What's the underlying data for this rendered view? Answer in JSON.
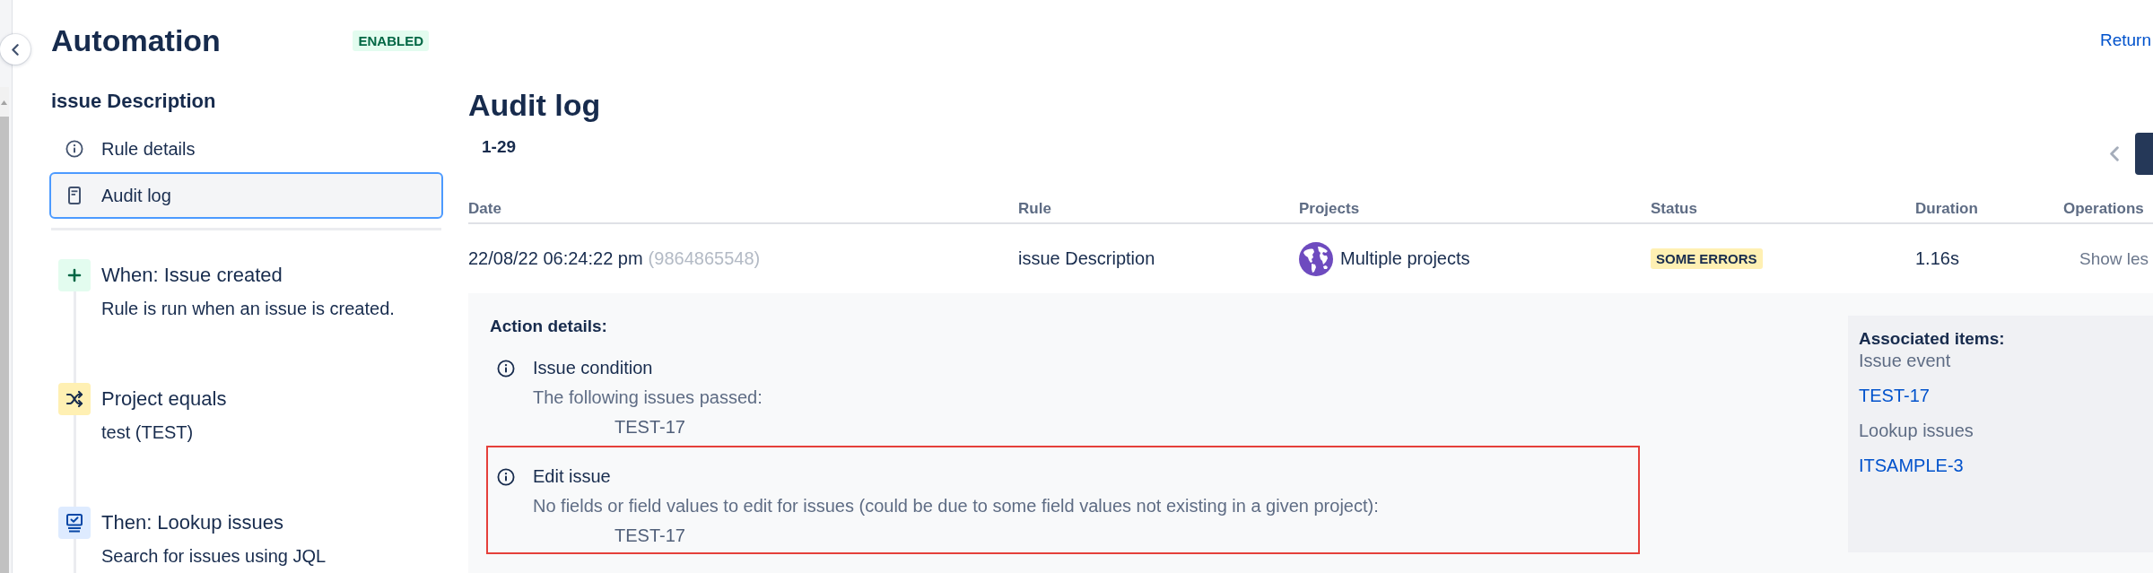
{
  "sidebar": {
    "title": "Automation",
    "status": "ENABLED",
    "rule_name": "issue Description",
    "nav": [
      {
        "label": "Rule details",
        "selected": false
      },
      {
        "label": "Audit log",
        "selected": true
      }
    ],
    "steps": [
      {
        "kind": "trigger",
        "title": "When: Issue created",
        "description": "Rule is run when an issue is created."
      },
      {
        "kind": "condition",
        "title": "Project equals",
        "description": "test (TEST)"
      },
      {
        "kind": "action",
        "title": "Then: Lookup issues",
        "description": "Search for issues using JQL"
      }
    ]
  },
  "header": {
    "link": "Return"
  },
  "audit_log": {
    "title": "Audit log",
    "range": "1-29"
  },
  "table": {
    "columns": [
      "Date",
      "Rule",
      "Projects",
      "Status",
      "Duration",
      "Operations"
    ],
    "rows": [
      {
        "date": "22/08/22 06:24:22 pm",
        "execution_id": "(9864865548)",
        "rule": "issue Description",
        "projects": "Multiple projects",
        "status": "SOME ERRORS",
        "duration": "1.16s",
        "operation": "Show les",
        "expanded": true,
        "details": {
          "title": "Action details:",
          "actions": [
            {
              "title": "Issue condition",
              "message": "The following issues passed:",
              "issues": [
                "TEST-17"
              ],
              "highlighted": false
            },
            {
              "title": "Edit issue",
              "message": "No fields or field values to edit for issues (could be due to some field values not existing in a given project):",
              "issues": [
                "TEST-17"
              ],
              "highlighted": true
            }
          ],
          "associated": {
            "title": "Associated items:",
            "groups": [
              {
                "label": "Issue event",
                "links": [
                  "TEST-17"
                ]
              },
              {
                "label": "Lookup issues",
                "links": [
                  "ITSAMPLE-3"
                ]
              }
            ]
          }
        }
      }
    ]
  }
}
